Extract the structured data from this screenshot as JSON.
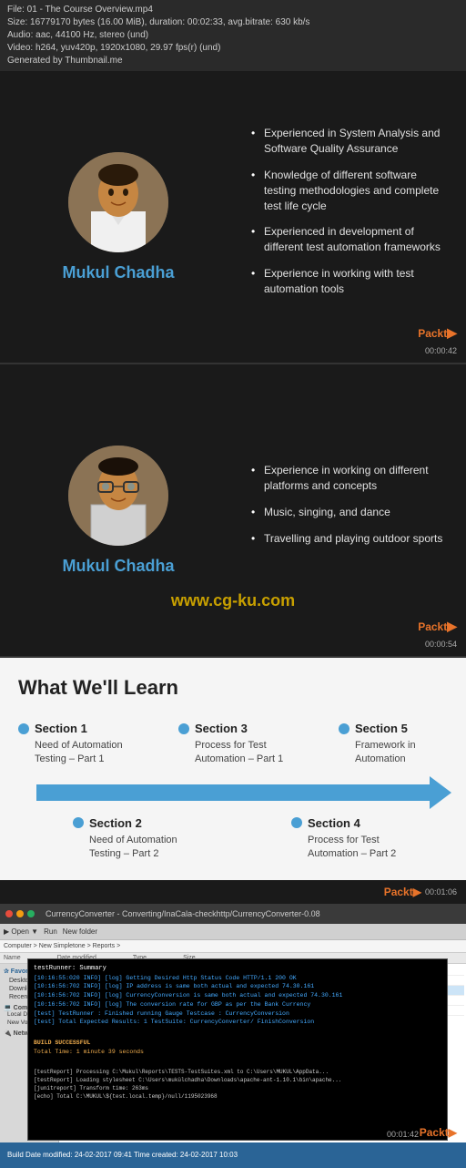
{
  "topbar": {
    "line1": "File: 01 - The Course Overview.mp4",
    "line2": "Size: 16779170 bytes (16.00 MiB), duration: 00:02:33, avg.bitrate: 630 kb/s",
    "line3": "Audio: aac, 44100 Hz, stereo (und)",
    "line4": "Video: h264, yuv420p, 1920x1080, 29.97 fps(r) (und)",
    "line5": "Generated by Thumbnail.me"
  },
  "slide1": {
    "speaker_name": "Mukul Chadha",
    "timestamp": "00:00:42",
    "bullets": [
      "Experienced in System Analysis and Software Quality Assurance",
      "Knowledge of different software testing methodologies and complete test life cycle",
      "Experienced in development of different test automation frameworks",
      "Experience in working with test automation tools"
    ]
  },
  "slide2": {
    "speaker_name": "Mukul Chadha",
    "timestamp": "00:00:54",
    "watermark": "www.cg-ku.com",
    "bullets": [
      "Experience in working on different platforms and concepts",
      "Music, singing, and dance",
      "Travelling and playing outdoor sports"
    ]
  },
  "learn_section": {
    "title": "What We'll Learn",
    "timestamp": "00:01:06",
    "sections_top": [
      {
        "num": "Section 1",
        "desc": "Need of Automation Testing – Part 1"
      },
      {
        "num": "Section 3",
        "desc": "Process for Test Automation – Part 1"
      },
      {
        "num": "Section 5",
        "desc": "Framework in Automation"
      }
    ],
    "sections_bottom": [
      {
        "num": "Section 2",
        "desc": "Need of Automation Testing – Part 2"
      },
      {
        "num": "Section 4",
        "desc": "Process for Test Automation – Part 2"
      }
    ]
  },
  "terminal_section": {
    "timestamp": "00:01:42",
    "terminal_lines": [
      "[10:16:55:020 INFO] [log] Getting Desired Http Status Code HTTP/1.1 200 OK",
      "[10:16:55:020 INFO] [log] IP address is same both actual and expected 74.30.161",
      "[10:16:55:020 INFO] [log] CurrencyConversion is same both actual and expected 74.30.161",
      "[10:16:55:020 INFO] [log] The conversion rate for GBP as per the Bank Currency",
      "[test] TestRunner : Finished running Gauge Testcase : CurrencyConversion",
      "[test] Total Expected Results: 1   TestSuite: CurrencyConverter/  FinishConversion",
      "",
      "BUILD SUCCESSFUL",
      "Total Time: 1 minute 39 seconds",
      "",
      "[testReport] Processing C:\\Mukul\\Reports\\TESTS-TestSuites.xml to C:\\Users\\MUKUL\\AppData...",
      "[testReport] Loading stylesheet C:\\Users\\mukülchadha\\Downloads\\apache-ant-1.10.1\\bin\\apache...",
      "[junitreport] Transform time: 263ms",
      "[echo] Total C:\\MUKUL\\${test.local.temp}/null/1195023968"
    ],
    "bottom_bar": "Build  Date modified: 24-02-2017 09:41  Time created: 24-02-2017 10:03"
  },
  "packt": {
    "logo": "Packt▶"
  }
}
